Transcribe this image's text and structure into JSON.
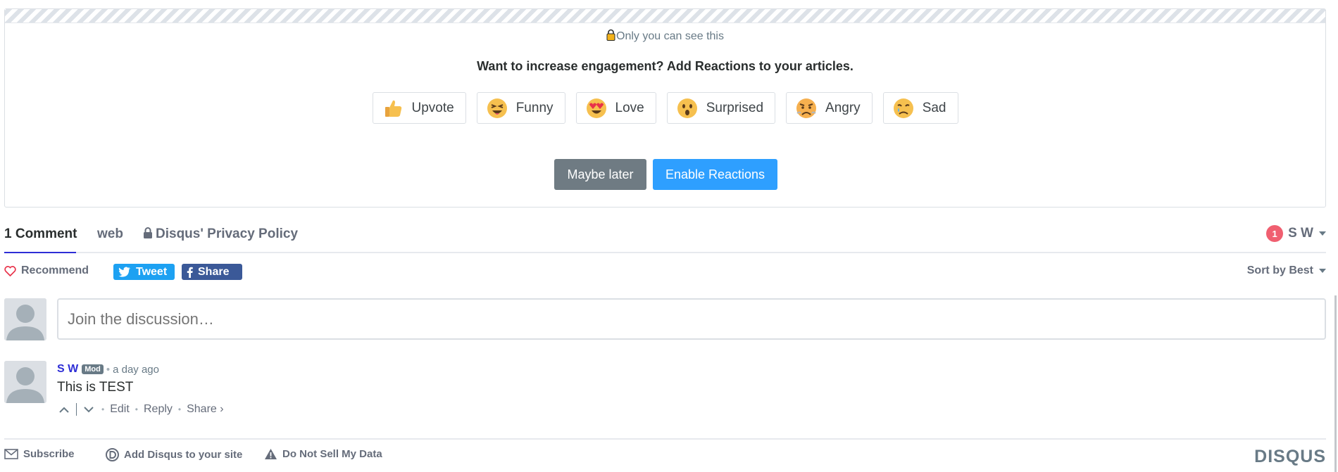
{
  "promo": {
    "private_note": "Only you can see this",
    "title": "Want to increase engagement? Add Reactions to your articles.",
    "reactions": [
      {
        "label": "Upvote",
        "icon": "thumbs-up-icon"
      },
      {
        "label": "Funny",
        "icon": "laughing-face-icon"
      },
      {
        "label": "Love",
        "icon": "heart-eyes-face-icon"
      },
      {
        "label": "Surprised",
        "icon": "surprised-face-icon"
      },
      {
        "label": "Angry",
        "icon": "angry-face-icon"
      },
      {
        "label": "Sad",
        "icon": "sad-face-icon"
      }
    ],
    "maybe_later": "Maybe later",
    "enable": "Enable Reactions"
  },
  "nav": {
    "comments_tab": "1 Comment",
    "community_tab": "web",
    "privacy_tab": "Disqus' Privacy Policy",
    "notification_count": "1",
    "username": "S W"
  },
  "toolbar": {
    "recommend": "Recommend",
    "tweet": "Tweet",
    "share": "Share",
    "sort": "Sort by Best"
  },
  "composer": {
    "placeholder": "Join the discussion…"
  },
  "comment": {
    "author": "S W",
    "badge": "Mod",
    "separator": "•",
    "time": "a day ago",
    "text": "This is TEST",
    "edit": "Edit",
    "reply": "Reply",
    "share": "Share ›"
  },
  "footer": {
    "subscribe": "Subscribe",
    "add_disqus": "Add Disqus to your site",
    "do_not_sell": "Do Not Sell My Data",
    "brand": "DISQUS"
  },
  "colors": {
    "accent": "#2e9fff",
    "link": "#2e2ed6",
    "notification": "#f05f70",
    "twitter": "#1da1f2",
    "facebook": "#3b5998"
  }
}
